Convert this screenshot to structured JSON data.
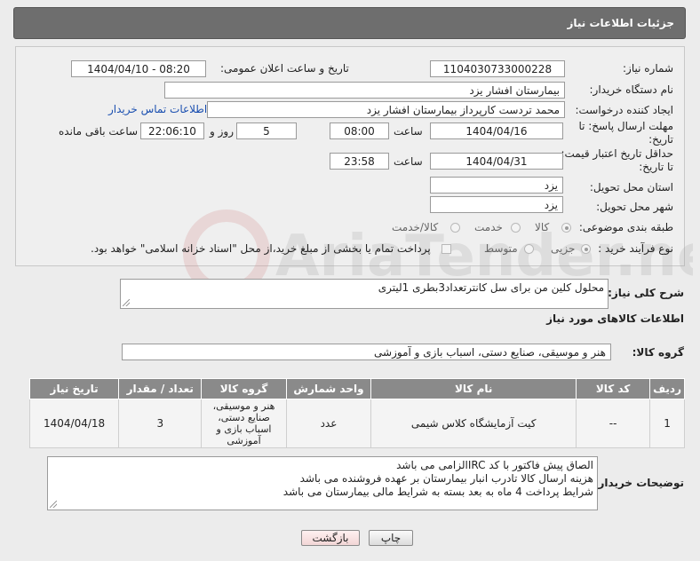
{
  "header": {
    "title": "جزئیات اطلاعات نیاز"
  },
  "fields": {
    "need_number_label": "شماره نیاز:",
    "need_number": "1104030733000228",
    "announce_label": "تاریخ و ساعت اعلان عمومی:",
    "announce_value": "1404/04/10 - 08:20",
    "buyer_label": "نام دستگاه خریدار:",
    "buyer": "بیمارستان افشار یزد",
    "creator_label": "ایجاد کننده درخواست:",
    "creator": "محمد تردست کارپرداز بیمارستان افشار یزد",
    "contact_link": "اطلاعات تماس خریدار",
    "deadline_label_1": "مهلت ارسال پاسخ: تا",
    "deadline_label_2": "تاریخ:",
    "deadline_date": "1404/04/16",
    "time_label": "ساعت",
    "deadline_time": "08:00",
    "days_value": "5",
    "days_label": "روز و",
    "remaining_time": "22:06:10",
    "remaining_label": "ساعت باقی مانده",
    "validity_label_1": "حداقل تاریخ اعتبار قیمت:",
    "validity_label_2": "تا تاریخ:",
    "validity_date": "1404/04/31",
    "validity_time": "23:58",
    "province_label": "استان محل تحویل:",
    "province": "یزد",
    "city_label": "شهر محل تحویل:",
    "city": "یزد",
    "category_label": "طبقه بندی موضوعی:",
    "category_options": [
      "کالا",
      "خدمت",
      "کالا/خدمت"
    ],
    "process_label": "نوع فرآیند خرید :",
    "process_options": [
      "جزیی",
      "متوسط"
    ],
    "payment_note": "پرداخت تمام یا بخشی از مبلغ خرید،از محل \"اسناد خزانه اسلامی\" خواهد بود."
  },
  "summary": {
    "label": "شرح کلی نیاز:",
    "text": "محلول کلین من برای سل کانترتعداد3بطری 1لیتری"
  },
  "goods_section": {
    "title": "اطلاعات کالاهای مورد نیاز",
    "group_label": "گروه کالا:",
    "group_value": "هنر و موسیقی، صنایع دستی، اسباب بازی و آموزشی"
  },
  "table": {
    "headers": [
      "ردیف",
      "کد کالا",
      "نام کالا",
      "واحد شمارش",
      "گروه کالا",
      "تعداد / مقدار",
      "تاریخ نیاز"
    ],
    "rows": [
      [
        "1",
        "--",
        "کیت آزمایشگاه کلاس شیمی",
        "عدد",
        "هنر و موسیقی، صنایع دستی، اسباب بازی و آموزشی",
        "3",
        "1404/04/18"
      ]
    ]
  },
  "buyer_notes": {
    "label": "توضیحات خریدار:",
    "lines": [
      "الصاق پیش فاکتور با کد IRCالزامی می باشد",
      "هزینه ارسال کالا تادرب انبار بیمارستان بر عهده فروشنده می باشد",
      "شرایط پرداخت 4 ماه به بعد بسته به شرایط مالی بیمارستان می باشد"
    ]
  },
  "buttons": {
    "print": "چاپ",
    "back": "بازگشت"
  }
}
